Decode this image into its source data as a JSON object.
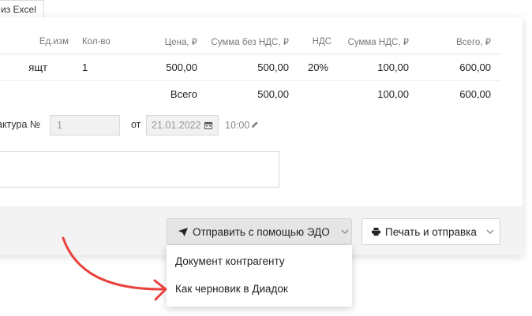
{
  "tab": {
    "label": "из Excel"
  },
  "table": {
    "headers": [
      "Ед.изм",
      "Кол-во",
      "Цена, ₽",
      "Сумма без НДС, ₽",
      "НДС",
      "Сумма НДС, ₽",
      "Всего, ₽"
    ],
    "row": {
      "unit": "ящт",
      "qty": "1",
      "price": "500,00",
      "sum_no_vat": "500,00",
      "vat": "20%",
      "vat_sum": "100,00",
      "total": "600,00"
    },
    "total": {
      "label": "Всего",
      "sum_no_vat": "500,00",
      "vat_sum": "100,00",
      "total": "600,00"
    }
  },
  "invoice": {
    "label": "актура №",
    "number_value": "1",
    "from_label": "от",
    "date_value": "21.01.2022",
    "time_value": "10:00"
  },
  "buttons": {
    "send_edo": "Отправить с помощью ЭДО",
    "print_send": "Печать и отправка"
  },
  "dropdown": {
    "items": [
      "Документ контрагенту",
      "Как черновик в Диадок"
    ]
  },
  "colors": {
    "arrow": "#e8413c",
    "footer_bg": "#f3f3f3"
  }
}
